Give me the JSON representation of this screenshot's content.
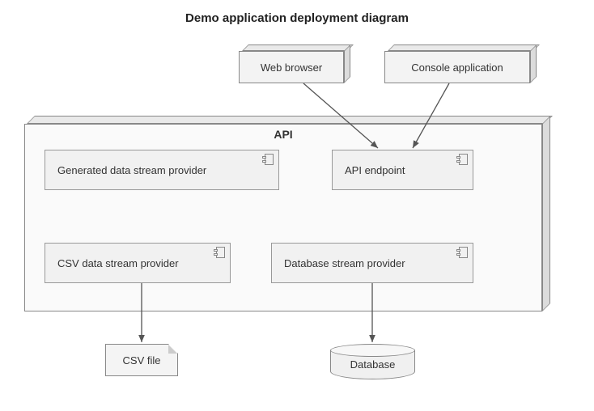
{
  "title": "Demo application deployment diagram",
  "nodes": {
    "web_browser": "Web browser",
    "console_app": "Console application",
    "api": "API",
    "gen_provider": "Generated data stream provider",
    "api_endpoint": "API endpoint",
    "csv_provider": "CSV data stream provider",
    "db_provider": "Database stream provider",
    "csv_file": "CSV file",
    "database": "Database"
  },
  "edges": [
    {
      "from": "web_browser",
      "to": "api_endpoint"
    },
    {
      "from": "console_app",
      "to": "api_endpoint"
    },
    {
      "from": "csv_provider",
      "to": "csv_file"
    },
    {
      "from": "db_provider",
      "to": "database"
    }
  ],
  "colors": {
    "node_fill": "#f1f1f1",
    "node_border": "#888888",
    "arrow": "#555555"
  }
}
